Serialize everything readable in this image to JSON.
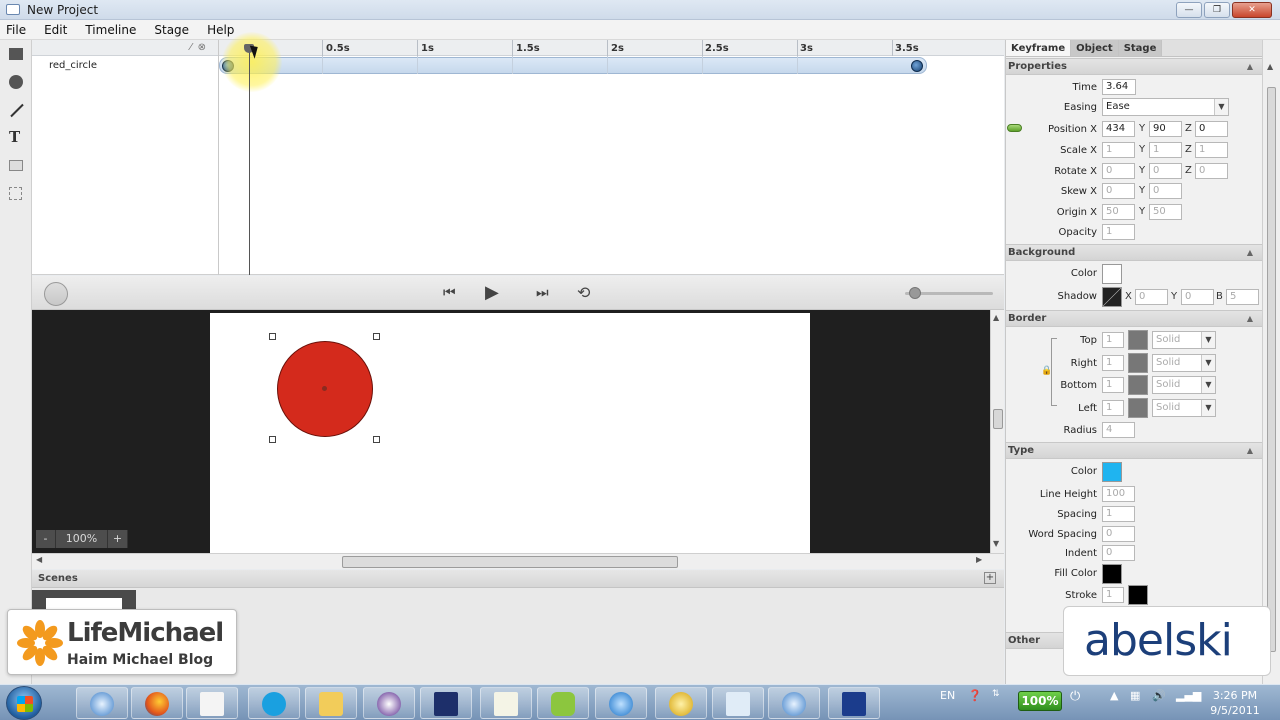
{
  "window": {
    "title": "New Project",
    "buttons": {
      "minimize": "—",
      "maximize": "❐",
      "close": "✕"
    }
  },
  "menubar": {
    "items": [
      "File",
      "Edit",
      "Timeline",
      "Stage",
      "Help"
    ]
  },
  "timeline": {
    "layers": [
      {
        "name": "red_circle"
      }
    ],
    "ruler": [
      "0.5s",
      "1s",
      "1.5s",
      "2s",
      "2.5s",
      "3s",
      "3.5s"
    ]
  },
  "stage": {
    "zoom": "100%",
    "zoom_minus": "-",
    "zoom_plus": "+",
    "circle_color": "#d42a1c",
    "background": "#1f1f1f"
  },
  "scenes": {
    "label": "Scenes",
    "add": "+"
  },
  "panel": {
    "tabs": [
      "Keyframe",
      "Object",
      "Stage"
    ],
    "properties": {
      "header": "Properties",
      "time_label": "Time",
      "time": "3.64",
      "easing_label": "Easing",
      "easing": "Ease",
      "position_label": "Position X",
      "pos_x": "434",
      "pos_y": "90",
      "pos_z": "0",
      "scale_label": "Scale X",
      "scale_x": "1",
      "scale_y": "1",
      "scale_z": "1",
      "rotate_label": "Rotate X",
      "rot_x": "0",
      "rot_y": "0",
      "rot_z": "0",
      "skew_label": "Skew X",
      "skew_x": "0",
      "skew_y": "0",
      "origin_label": "Origin X",
      "origin_x": "50",
      "origin_y": "50",
      "opacity_label": "Opacity",
      "opacity": "1",
      "axis_y": "Y",
      "axis_z": "Z"
    },
    "background": {
      "header": "Background",
      "color_label": "Color",
      "shadow_label": "Shadow",
      "shadow_x": "0",
      "shadow_y": "0",
      "shadow_b": "5",
      "axis_x": "X",
      "axis_y": "Y",
      "axis_b": "B"
    },
    "border": {
      "header": "Border",
      "rows": [
        {
          "label": "Top",
          "width": "1",
          "style": "Solid"
        },
        {
          "label": "Right",
          "width": "1",
          "style": "Solid"
        },
        {
          "label": "Bottom",
          "width": "1",
          "style": "Solid"
        },
        {
          "label": "Left",
          "width": "1",
          "style": "Solid"
        }
      ],
      "radius_label": "Radius",
      "radius": "4"
    },
    "type": {
      "header": "Type",
      "color_label": "Color",
      "color": "#1fb4f0",
      "line_height_label": "Line Height",
      "line_height": "100",
      "spacing_label": "Spacing",
      "spacing": "1",
      "word_spacing_label": "Word Spacing",
      "word_spacing": "0",
      "indent_label": "Indent",
      "indent": "0",
      "fill_color_label": "Fill Color",
      "stroke_label": "Stroke",
      "stroke": "1"
    },
    "other": {
      "header": "Other"
    }
  },
  "overlays": {
    "lifemichael_name": "LifeMichael",
    "lifemichael_sub": "Haim Michael Blog",
    "abelski": "abelski"
  },
  "taskbar": {
    "lang": "EN",
    "battery": "100%",
    "time": "3:26 PM",
    "date": "9/5/2011"
  }
}
